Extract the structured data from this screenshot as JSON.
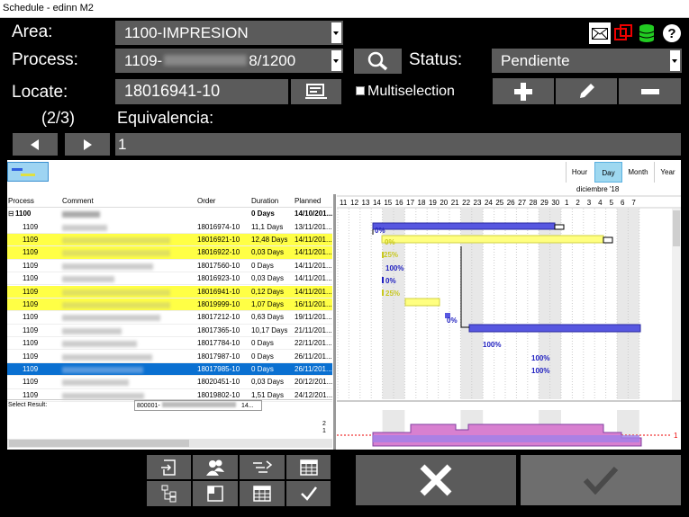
{
  "window_title": "Schedule - edinn M2",
  "form": {
    "area_label": "Area:",
    "area_value": "1100-IMPRESION",
    "process_label": "Process:",
    "process_prefix": "1109-",
    "process_suffix": "8/1200",
    "status_label": "Status:",
    "status_value": "Pendiente",
    "locate_label": "Locate:",
    "locate_value": "18016941-10",
    "multiselection_label": "Multiselection",
    "counter": "(2/3)",
    "equivalencia_label": "Equivalencia:",
    "page_value": "1"
  },
  "gantt": {
    "scale_buttons": [
      "Hour",
      "Day",
      "Month",
      "Year"
    ],
    "active_scale": "Day",
    "month_label": "diciembre '18",
    "days": [
      "11",
      "12",
      "13",
      "14",
      "15",
      "16",
      "17",
      "18",
      "19",
      "20",
      "21",
      "22",
      "23",
      "24",
      "25",
      "26",
      "27",
      "28",
      "29",
      "30",
      "1",
      "2",
      "3",
      "4",
      "5",
      "6",
      "7"
    ],
    "percent_labels": [
      "0%",
      "0%",
      "25%",
      "100%",
      "0%",
      "25%",
      "0%",
      "100%",
      "100%",
      "100%"
    ],
    "load_scale": [
      "2",
      "1"
    ],
    "load_right_label": "1"
  },
  "table": {
    "headers": [
      "Process",
      "Comment",
      "Order",
      "Duration",
      "Planned"
    ],
    "group": {
      "process": "1100",
      "duration": "0 Days",
      "planned": "14/10/201..."
    },
    "rows": [
      {
        "process": "1109",
        "order": "18016974-10",
        "duration": "11,1 Days",
        "planned": "13/11/201...",
        "style": "normal"
      },
      {
        "process": "1109",
        "order": "18016921-10",
        "duration": "12,48 Days",
        "planned": "14/11/201...",
        "style": "yellow"
      },
      {
        "process": "1109",
        "order": "18016922-10",
        "duration": "0,03 Days",
        "planned": "14/11/201...",
        "style": "yellow"
      },
      {
        "process": "1109",
        "order": "18017560-10",
        "duration": "0 Days",
        "planned": "14/11/201...",
        "style": "normal"
      },
      {
        "process": "1109",
        "order": "18016923-10",
        "duration": "0,03 Days",
        "planned": "14/11/201...",
        "style": "normal"
      },
      {
        "process": "1109",
        "order": "18016941-10",
        "duration": "0,12 Days",
        "planned": "14/11/201...",
        "style": "yellow"
      },
      {
        "process": "1109",
        "order": "18019999-10",
        "duration": "1,07 Days",
        "planned": "16/11/201...",
        "style": "yellow"
      },
      {
        "process": "1109",
        "order": "18017212-10",
        "duration": "0,63 Days",
        "planned": "19/11/201...",
        "style": "normal"
      },
      {
        "process": "1109",
        "order": "18017365-10",
        "duration": "10,17 Days",
        "planned": "21/11/201...",
        "style": "normal"
      },
      {
        "process": "1109",
        "order": "18017784-10",
        "duration": "0 Days",
        "planned": "22/11/201...",
        "style": "normal"
      },
      {
        "process": "1109",
        "order": "18017987-10",
        "duration": "0 Days",
        "planned": "26/11/201...",
        "style": "normal"
      },
      {
        "process": "1109",
        "order": "18017985-10",
        "duration": "0 Days",
        "planned": "26/11/201...",
        "style": "selected"
      },
      {
        "process": "1109",
        "order": "18020451-10",
        "duration": "0,03 Days",
        "planned": "20/12/201...",
        "style": "normal"
      },
      {
        "process": "1109",
        "order": "18019802-10",
        "duration": "1,51 Days",
        "planned": "24/12/201...",
        "style": "normal"
      }
    ],
    "select_result_label": "Select Result:",
    "select_result_value": "800001-",
    "select_result_suffix": "14..."
  },
  "colors": {
    "dark_button": "#5b5b5b",
    "selected_row": "#0a70d1",
    "highlight_row": "#ffff45",
    "bar_blue": "#5757e0",
    "bar_yellow": "#ffff80"
  }
}
